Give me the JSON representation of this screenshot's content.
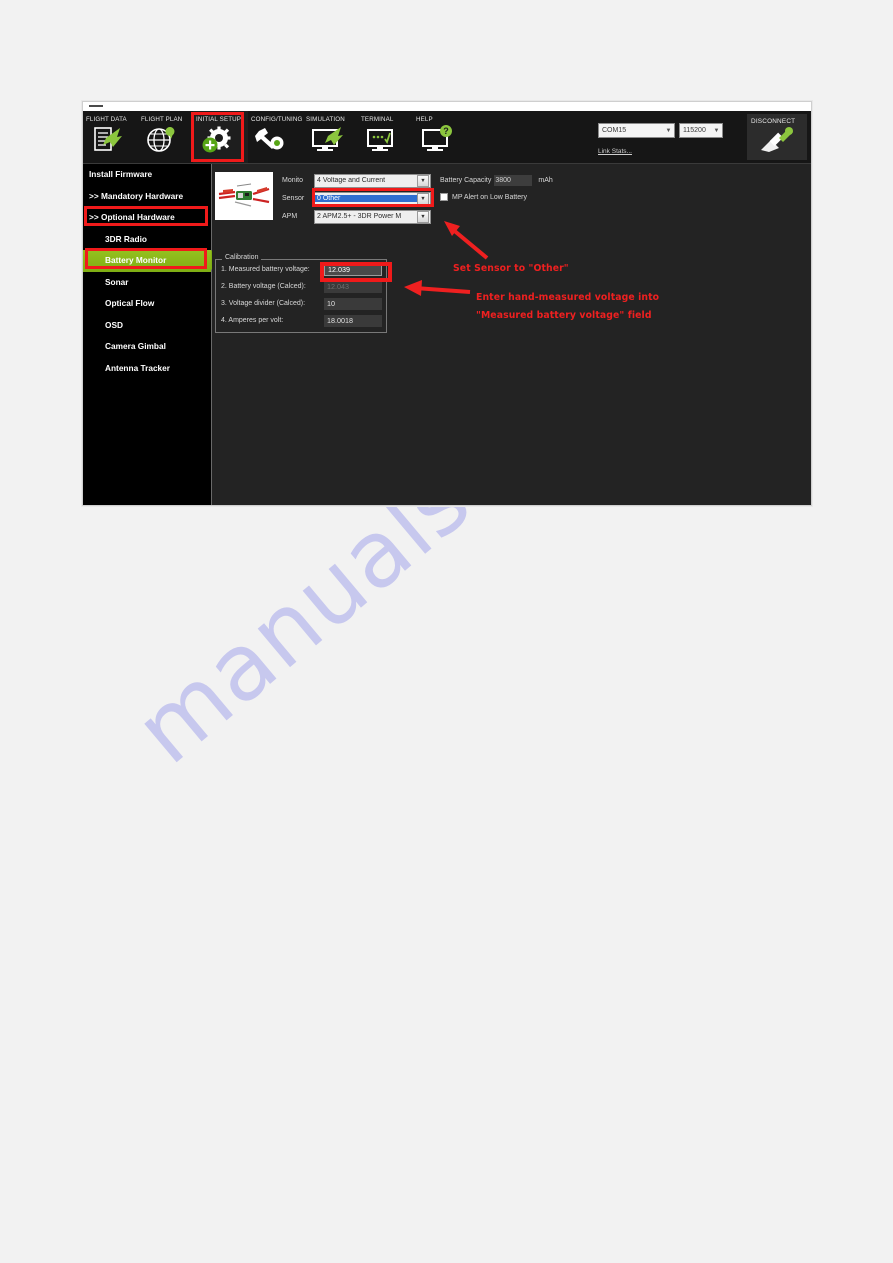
{
  "window": {
    "title_bar_dash": "-"
  },
  "topnav": {
    "tabs": [
      {
        "label": "FLIGHT DATA",
        "icon": "flight-data-icon",
        "selected": false
      },
      {
        "label": "FLIGHT PLAN",
        "icon": "flight-plan-globe-icon",
        "selected": false
      },
      {
        "label": "INITIAL SETUP",
        "icon": "initial-setup-gear-icon",
        "selected": true
      },
      {
        "label": "CONFIG/TUNING",
        "icon": "config-tuning-wrench-icon",
        "selected": false
      },
      {
        "label": "SIMULATION",
        "icon": "simulation-monitor-icon",
        "selected": false
      },
      {
        "label": "TERMINAL",
        "icon": "terminal-monitor-icon",
        "selected": false
      },
      {
        "label": "HELP",
        "icon": "help-monitor-icon",
        "selected": false
      }
    ],
    "com_port": "COM15",
    "baud_rate": "115200",
    "link_stats_label": "Link Stats...",
    "disconnect_label": "DISCONNECT",
    "disconnect_icon": "plug-icon",
    "dropdown_arrow": "▼"
  },
  "sidebar": {
    "items": [
      {
        "label": "Install Firmware",
        "indent": false,
        "active": false
      },
      {
        "label": ">> Mandatory Hardware",
        "indent": false,
        "active": false
      },
      {
        "label": ">> Optional Hardware",
        "indent": false,
        "active": false
      },
      {
        "label": "3DR Radio",
        "indent": true,
        "active": false
      },
      {
        "label": "Battery Monitor",
        "indent": true,
        "active": true
      },
      {
        "label": "Sonar",
        "indent": true,
        "active": false
      },
      {
        "label": "Optical Flow",
        "indent": true,
        "active": false
      },
      {
        "label": "OSD",
        "indent": true,
        "active": false
      },
      {
        "label": "Camera Gimbal",
        "indent": true,
        "active": false
      },
      {
        "label": "Antenna Tracker",
        "indent": true,
        "active": false
      }
    ]
  },
  "main": {
    "thumbnail_name": "power-module-photo",
    "fields": [
      {
        "label": "Monito",
        "value": "4 Voltage and Current",
        "selected": false
      },
      {
        "label": "Sensor",
        "value": "0  Other",
        "selected": true
      },
      {
        "label": "APM",
        "value": "2  APM2.5+ - 3DR Power M",
        "selected": false
      }
    ],
    "battery_capacity_label": "Battery Capacity",
    "battery_capacity_value": "3800",
    "battery_capacity_unit": "mAh",
    "mp_alert_label": "MP Alert on Low Battery",
    "mp_alert_checked": false,
    "calibration": {
      "legend": "Calibration",
      "rows": [
        {
          "label": "1. Measured battery voltage:",
          "value": "12.039",
          "style": "editable"
        },
        {
          "label": "2. Battery voltage (Calced):",
          "value": "12.043",
          "style": "dim"
        },
        {
          "label": "3. Voltage divider (Calced):",
          "value": "10",
          "style": "normal"
        },
        {
          "label": "4. Amperes per volt:",
          "value": "18.0018",
          "style": "normal"
        }
      ]
    },
    "dropdown_arrow": "▼"
  },
  "annotations": {
    "line1": "Set Sensor to \"Other\"",
    "line2": "Enter hand-measured voltage into",
    "line3": "\"Measured battery voltage\" field",
    "color": "#ef2020"
  },
  "watermark": {
    "text": "manualshive.com",
    "color": "#c7c8ee"
  },
  "colors": {
    "highlight_red": "#f01a1a",
    "active_green": "#95c11f",
    "window_bg": "#1b1b1b",
    "sidebar_bg": "#000000",
    "page_bg": "#f2f2f2"
  }
}
